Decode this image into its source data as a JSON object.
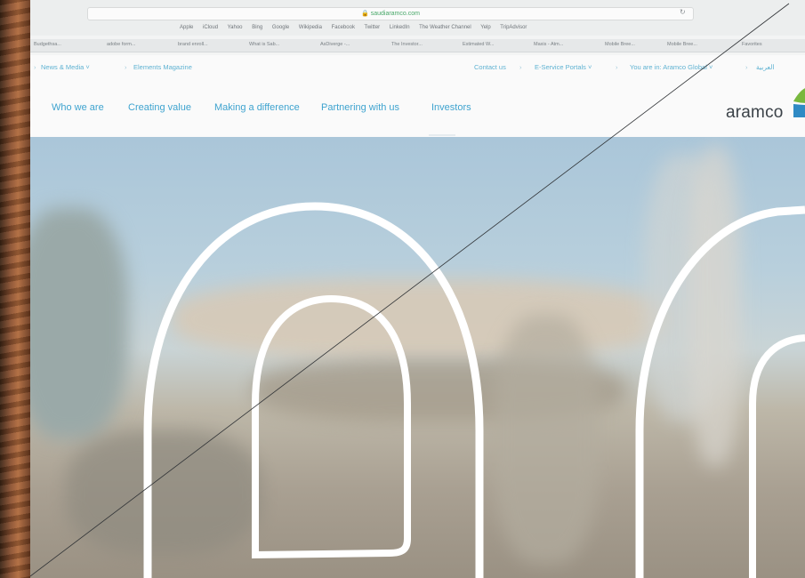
{
  "browser": {
    "url": "🔒 saudiaramco.com",
    "favorites": [
      "Apple",
      "iCloud",
      "Yahoo",
      "Bing",
      "Google",
      "Wikipedia",
      "Facebook",
      "Twitter",
      "LinkedIn",
      "The Weather Channel",
      "Yelp",
      "TripAdvisor"
    ],
    "bookmarks": [
      "Budgethsa...",
      "adobe form...",
      "brand enroll...",
      "What is Sab...",
      "AsDiverge -...",
      "The Investor...",
      "Estimated W...",
      "Maxis - Atm...",
      "Mobile Bree...",
      "Mobile Bree...",
      "Favorites"
    ]
  },
  "site": {
    "utility_left": [
      "News & Media ˅",
      "Elements Magazine"
    ],
    "utility_right": [
      "Contact us",
      "E-Service Portals ˅",
      "You are in: Aramco Global ˅",
      "العربية"
    ],
    "nav": [
      "Who we are",
      "Creating value",
      "Making a difference",
      "Partnering with us",
      "Investors"
    ],
    "logo": "aramco"
  },
  "colors": {
    "accent": "#3ea3cf",
    "logo_green": "#78b83e",
    "logo_blue": "#2f8ac4"
  }
}
